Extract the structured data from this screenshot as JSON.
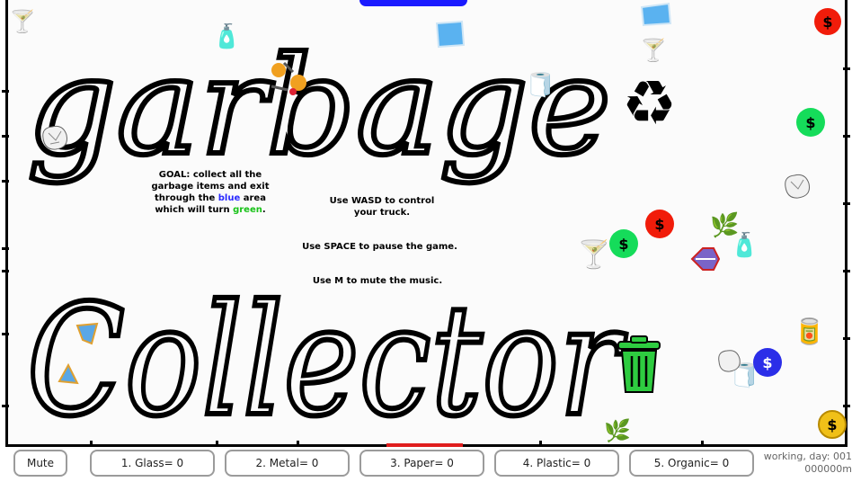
{
  "game": {
    "title_line1": "garbage",
    "title_line2": "Collector",
    "goal_prefix": "GOAL: collect all the garbage items and exit through the",
    "goal_blue_word": "blue",
    "goal_middle": "area which will turn",
    "goal_green_word": "green",
    "goal_suffix": ".",
    "controls": "Use WASD to control your truck.",
    "pause": "Use SPACE to pause the game.",
    "mute_hint": "Use M to mute the music."
  },
  "icons": {
    "coin_symbol": "$",
    "recycle_symbol": "♻",
    "glass": "🍸",
    "paper": "🧻",
    "organic": "🌿",
    "metal": "🥫",
    "plastic": "🧴",
    "trash": "🗑"
  },
  "hud": {
    "mute_label": "Mute",
    "glass_label": "1. Glass= 0",
    "metal_label": "2. Metal= 0",
    "paper_label": "3. Paper= 0",
    "plastic_label": "4. Plastic= 0",
    "organic_label": "5. Organic= 0",
    "status_line1": "working, day: 001",
    "status_line2": "000000m"
  },
  "colors": {
    "exit_area": "#1a1aff",
    "coin_red": "#f11c0a",
    "coin_green": "#15dc5a",
    "coin_blue": "#2b2ee8",
    "trash_can": "#2ecc40"
  }
}
